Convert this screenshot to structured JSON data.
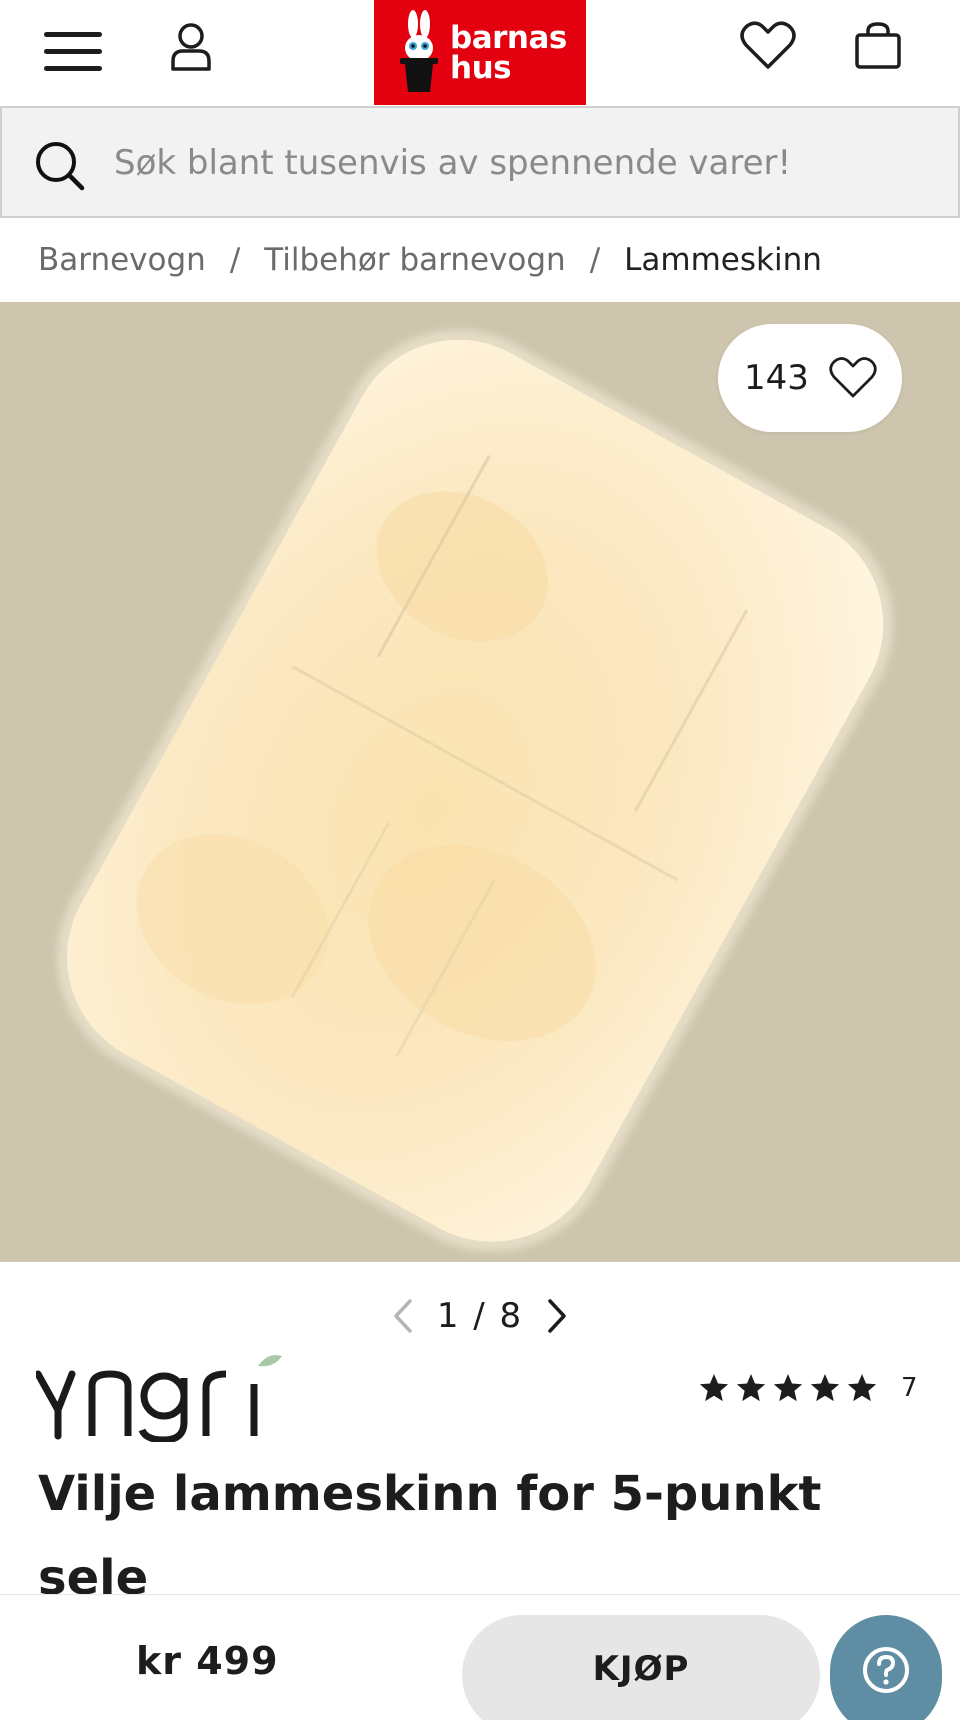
{
  "header": {
    "menu_icon": "hamburger-menu-icon",
    "user_icon": "user-icon",
    "logo_text_line1": "barnas",
    "logo_text_line2": "hus",
    "favorites_icon": "heart-icon",
    "cart_icon": "shopping-bag-icon",
    "brand_color": "#e3000f"
  },
  "search": {
    "placeholder": "Søk blant tusenvis av spennende varer!",
    "icon": "search-icon"
  },
  "breadcrumb": {
    "items": [
      "Barnevogn",
      "Tilbehør barnevogn",
      "Lammeskinn"
    ],
    "separator": "/"
  },
  "gallery": {
    "like_count": "143",
    "current_image": "1",
    "total_images": "8",
    "pager_separator": "/",
    "background_color": "#cec5ae"
  },
  "product": {
    "brand": "Yngri",
    "rating_stars": 5,
    "review_count": "7",
    "title": "Vilje lammeskinn for 5-punkt sele"
  },
  "bottom_bar": {
    "price": "kr 499",
    "buy_label": "KJØP",
    "help_icon": "question-mark-icon",
    "help_color": "#5f8da3"
  }
}
